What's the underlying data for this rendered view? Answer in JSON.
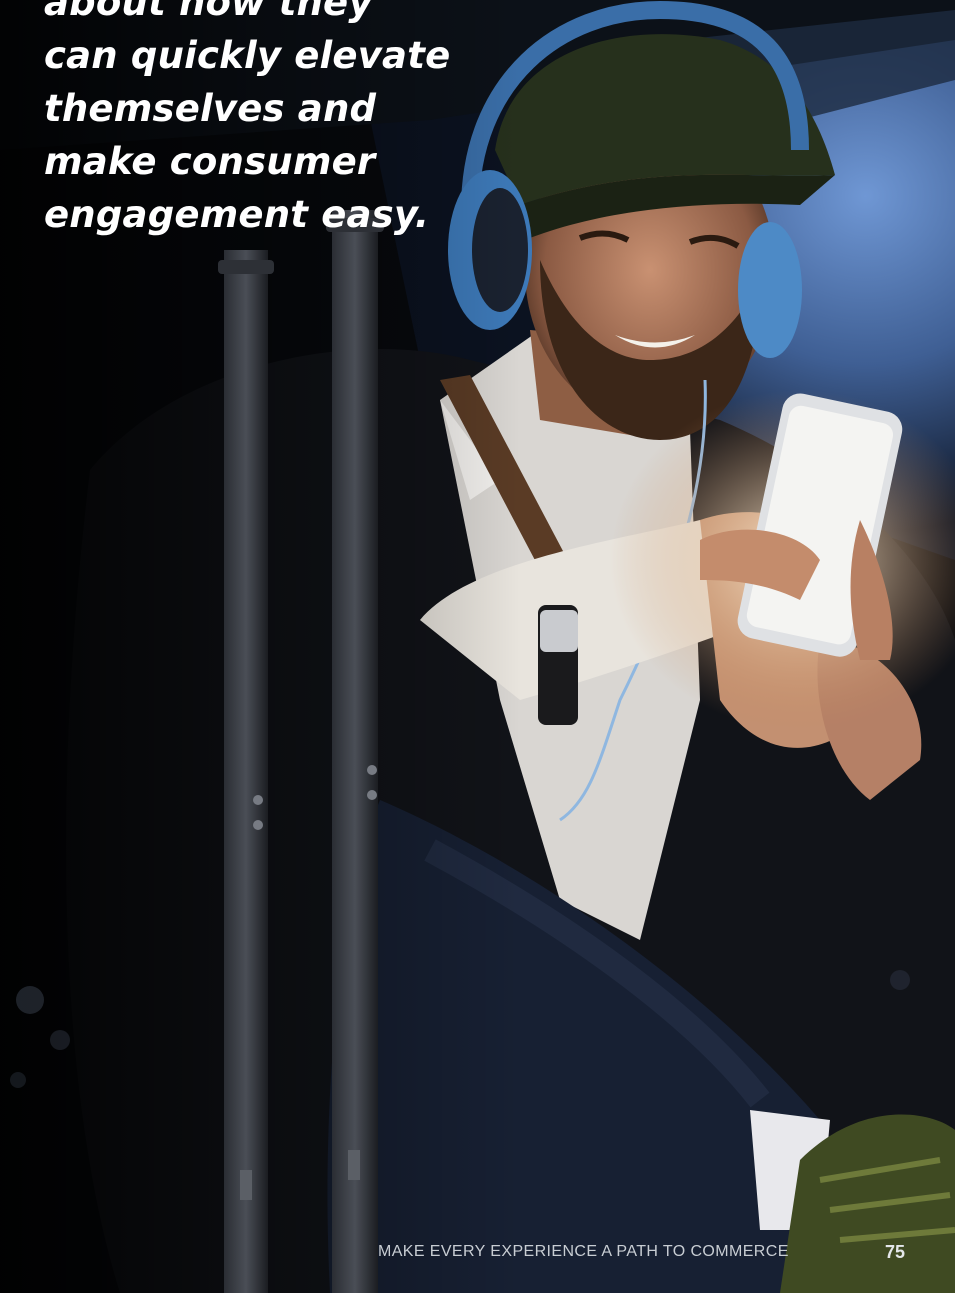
{
  "pull_quote": {
    "lines": [
      "about how they",
      "can quickly elevate",
      "themselves and",
      "make consumer",
      "engagement easy."
    ]
  },
  "footer": {
    "running_title": "MAKE EVERY EXPERIENCE A PATH TO COMMERCE",
    "page_number": "75"
  },
  "colors": {
    "quote_text": "#ffffff",
    "footer_text": "#c8cdd3",
    "sky": "#5d86c4",
    "background": "#050608"
  },
  "photo": {
    "subject": "smiling man with cap and headphones looking at smartphone at night beside luggage handle"
  }
}
